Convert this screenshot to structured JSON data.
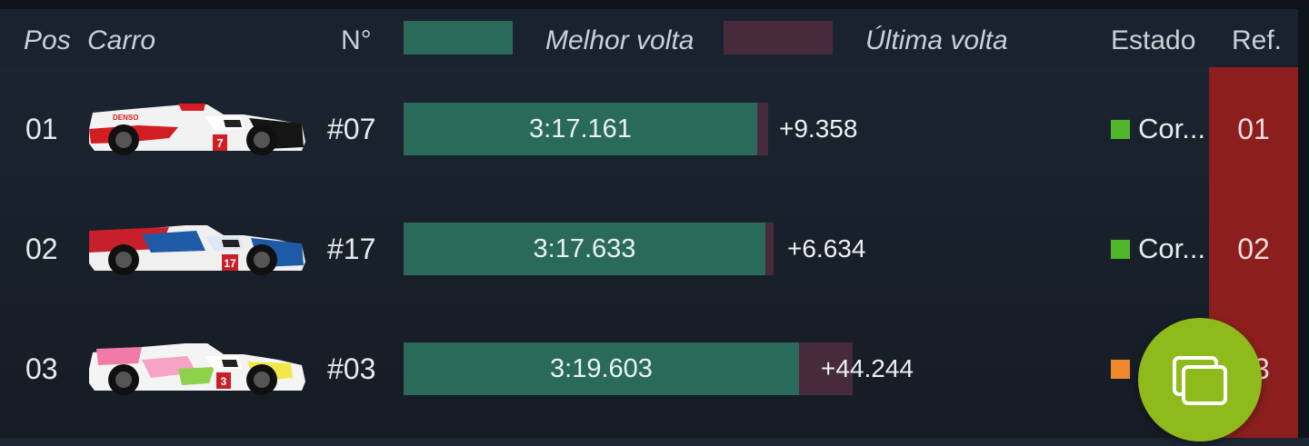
{
  "header": {
    "pos": "Pos",
    "car": "Carro",
    "number": "N°",
    "best_lap": "Melhor volta",
    "last_lap": "Última volta",
    "state": "Estado",
    "ref": "Ref."
  },
  "colors": {
    "best_bar": "#2a6a5b",
    "last_bar": "#472a3b",
    "ref_column": "#8c1f1e",
    "status_running": "#52b62a",
    "status_pit": "#ef8a2c",
    "fab": "#8fba1c"
  },
  "rows": [
    {
      "pos": "01",
      "car_icon": "toyota-hybrid-lmp1-car-icon",
      "number": "#07",
      "best_lap": "3:17.161",
      "gap": "+9.358",
      "status_color": "#52b62a",
      "status": "Cor...",
      "ref": "01"
    },
    {
      "pos": "02",
      "car_icon": "smp-racing-lmp1-car-icon",
      "number": "#17",
      "best_lap": "3:17.633",
      "gap": "+6.634",
      "status_color": "#52b62a",
      "status": "Cor...",
      "ref": "02"
    },
    {
      "pos": "03",
      "car_icon": "rebellion-lmp1-car-icon",
      "number": "#03",
      "best_lap": "3:19.603",
      "gap": "+44.244",
      "status_color": "#ef8a2c",
      "status": "",
      "ref": "03"
    }
  ],
  "fab": {
    "icon": "windows-overlay-icon"
  }
}
